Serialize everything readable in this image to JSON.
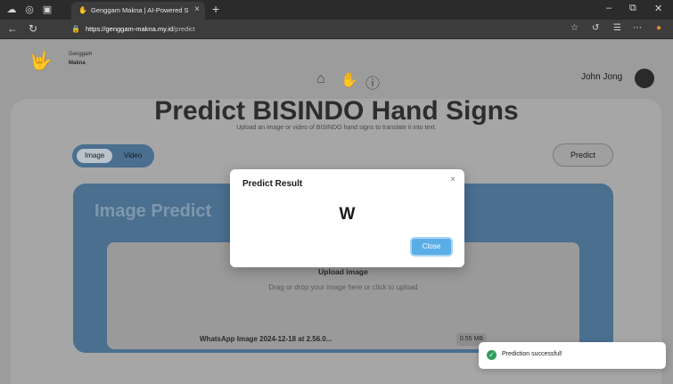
{
  "browser": {
    "tab_title": "Genggam Makna | AI-Powered Si",
    "tab_close": "×",
    "new_tab": "+",
    "url_host": "https://genggam-makna.my.id",
    "url_path": "/predict",
    "window_minimize": "–",
    "window_restore": "⧉",
    "window_close": "✕"
  },
  "header": {
    "brand_line1": "Genggam",
    "brand_line2": "Makna",
    "user_name": "John Jong"
  },
  "hero": {
    "title": "Predict BISINDO Hand Signs",
    "subtitle": "Upload an image or video of BISINDO hand signs to translate it into text."
  },
  "mode_toggle": {
    "image_label": "Image",
    "video_label": "Video",
    "selected": "Image"
  },
  "predict_button": "Predict",
  "panel": {
    "title": "Image Predict"
  },
  "upload": {
    "title": "Upload image",
    "subtitle": "Drag or drop your image here or click to upload",
    "file_name": "WhatsApp Image 2024-12-18 at 2.56.0...",
    "file_size": "0.55 MB"
  },
  "modal": {
    "title": "Predict Result",
    "close_x": "×",
    "result": "W",
    "close_button": "Close"
  },
  "toast": {
    "message": "Prediction successful!"
  },
  "colors": {
    "accent_blue": "#5aaee8",
    "panel_blue": "#4a6f8f",
    "success_green": "#2e9e5b"
  },
  "icons": [
    "home-icon",
    "hand-icon",
    "info-icon",
    "back-icon",
    "reload-icon",
    "lock-icon",
    "star-icon",
    "check-circle-icon"
  ]
}
